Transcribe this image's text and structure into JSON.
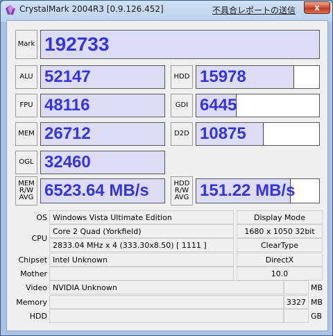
{
  "window": {
    "title": "CrystalMark 2004R3 [0.9.126.452]",
    "report_link": "不具合レポートの送信",
    "close_glyph": "x"
  },
  "scores": {
    "mark": {
      "label": "Mark",
      "value": "192733"
    },
    "alu": {
      "label": "ALU",
      "value": "52147",
      "fill": 1.0
    },
    "fpu": {
      "label": "FPU",
      "value": "48116",
      "fill": 1.0
    },
    "mem": {
      "label": "MEM",
      "value": "26712",
      "fill": 1.0
    },
    "ogl": {
      "label": "OGL",
      "value": "32460",
      "fill": 1.0
    },
    "hdd": {
      "label": "HDD",
      "value": "15978",
      "fill": 0.79
    },
    "gdi": {
      "label": "GDI",
      "value": "6445",
      "fill": 0.32
    },
    "d2d": {
      "label": "D2D",
      "value": "10875",
      "fill": 0.54
    },
    "mem_avg": {
      "label_l1": "MEM",
      "label_l2": "R/W",
      "label_l3": "AVG",
      "value": "6523.64 MB/s",
      "fill": 1.0
    },
    "hdd_avg": {
      "label_l1": "HDD",
      "label_l2": "R/W",
      "label_l3": "AVG",
      "value": "151.22 MB/s",
      "fill": 0.76
    }
  },
  "system": {
    "os_label": "OS",
    "os_value": "Windows Vista Ultimate Edition",
    "cpu_label": "CPU",
    "cpu_name": "Core 2 Quad (Yorkfield)",
    "cpu_detail": "2833.04 MHz x 4 (333.30x8.50) [ 1111 ]",
    "chipset_label": "Chipset",
    "chipset_value": "Intel Unknown",
    "mother_label": "Mother",
    "mother_value": "",
    "video_label": "Video",
    "video_value": "NVIDIA Unknown",
    "video_mem": "",
    "video_unit": "MB",
    "memory_label": "Memory",
    "memory_value": "",
    "memory_size": "3327",
    "memory_unit": "MB",
    "hdd_label": "HDD",
    "hdd_value": "",
    "hdd_size": "",
    "hdd_unit": "GB",
    "display_mode_label": "Display Mode",
    "display_mode_value": "1680 x 1050 32bit",
    "cleartype": "ClearType",
    "directx_label": "DirectX",
    "directx_value": "10.0"
  },
  "colors": {
    "score_text": "#3434e6",
    "score_fill": "#dcdcf4"
  }
}
